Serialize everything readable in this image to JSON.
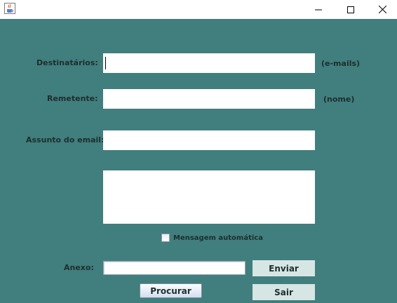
{
  "window": {
    "app_icon": "java-cup-icon",
    "controls": {
      "minimize": "minimize-icon",
      "maximize": "maximize-icon",
      "close": "close-icon"
    }
  },
  "form": {
    "destinatarios": {
      "label": "Destinatários:",
      "value": "",
      "hint": "(e-mails)"
    },
    "remetente": {
      "label": "Remetente:",
      "value": "",
      "hint": "(nome)"
    },
    "assunto": {
      "label": "Assunto do email:",
      "value": ""
    },
    "mensagem": {
      "value": ""
    },
    "mensagem_automatica": {
      "label": "Mensagem automática",
      "checked": false
    },
    "anexo": {
      "label": "Anexo:",
      "value": ""
    }
  },
  "buttons": {
    "enviar": "Enviar",
    "procurar": "Procurar",
    "sair": "Sair"
  },
  "colors": {
    "background": "#417e7e",
    "button_flat": "#d6e6e4",
    "field": "#ffffff"
  }
}
